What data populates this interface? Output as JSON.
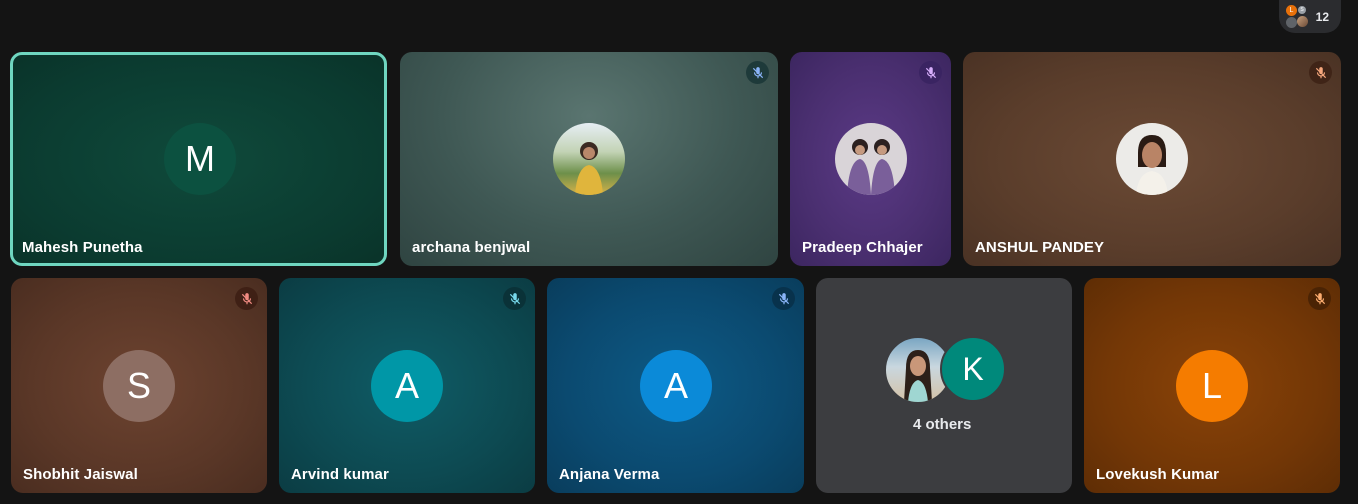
{
  "participant_count": "12",
  "participant_mini_avatars": [
    "L",
    "S"
  ],
  "tiles": [
    {
      "name": "Mahesh Punetha",
      "initial": "M",
      "avatar_color": "#0f5a44",
      "active": true,
      "muted": false
    },
    {
      "name": "archana benjwal",
      "avatar": "photo",
      "muted": true
    },
    {
      "name": "Pradeep Chhajer",
      "avatar": "photo",
      "muted": true
    },
    {
      "name": "ANSHUL PANDEY",
      "avatar": "photo",
      "muted": true
    },
    {
      "name": "Shobhit Jaiswal",
      "initial": "S",
      "avatar_color": "#8d6e63",
      "muted": true
    },
    {
      "name": "Arvind kumar",
      "initial": "A",
      "avatar_color": "#0097a7",
      "muted": true
    },
    {
      "name": "Anjana Verma",
      "initial": "A",
      "avatar_color": "#039be5",
      "muted": true
    },
    {
      "name": "4 others",
      "initial": "K",
      "avatar_color": "#00897b",
      "muted": false
    },
    {
      "name": "Lovekush Kumar",
      "initial": "L",
      "avatar_color": "#f57c00",
      "muted": true
    }
  ],
  "colors": {
    "active_border": "#6fd6c0",
    "background": "#141414"
  },
  "icons": {
    "muted": "mic-off-icon"
  }
}
